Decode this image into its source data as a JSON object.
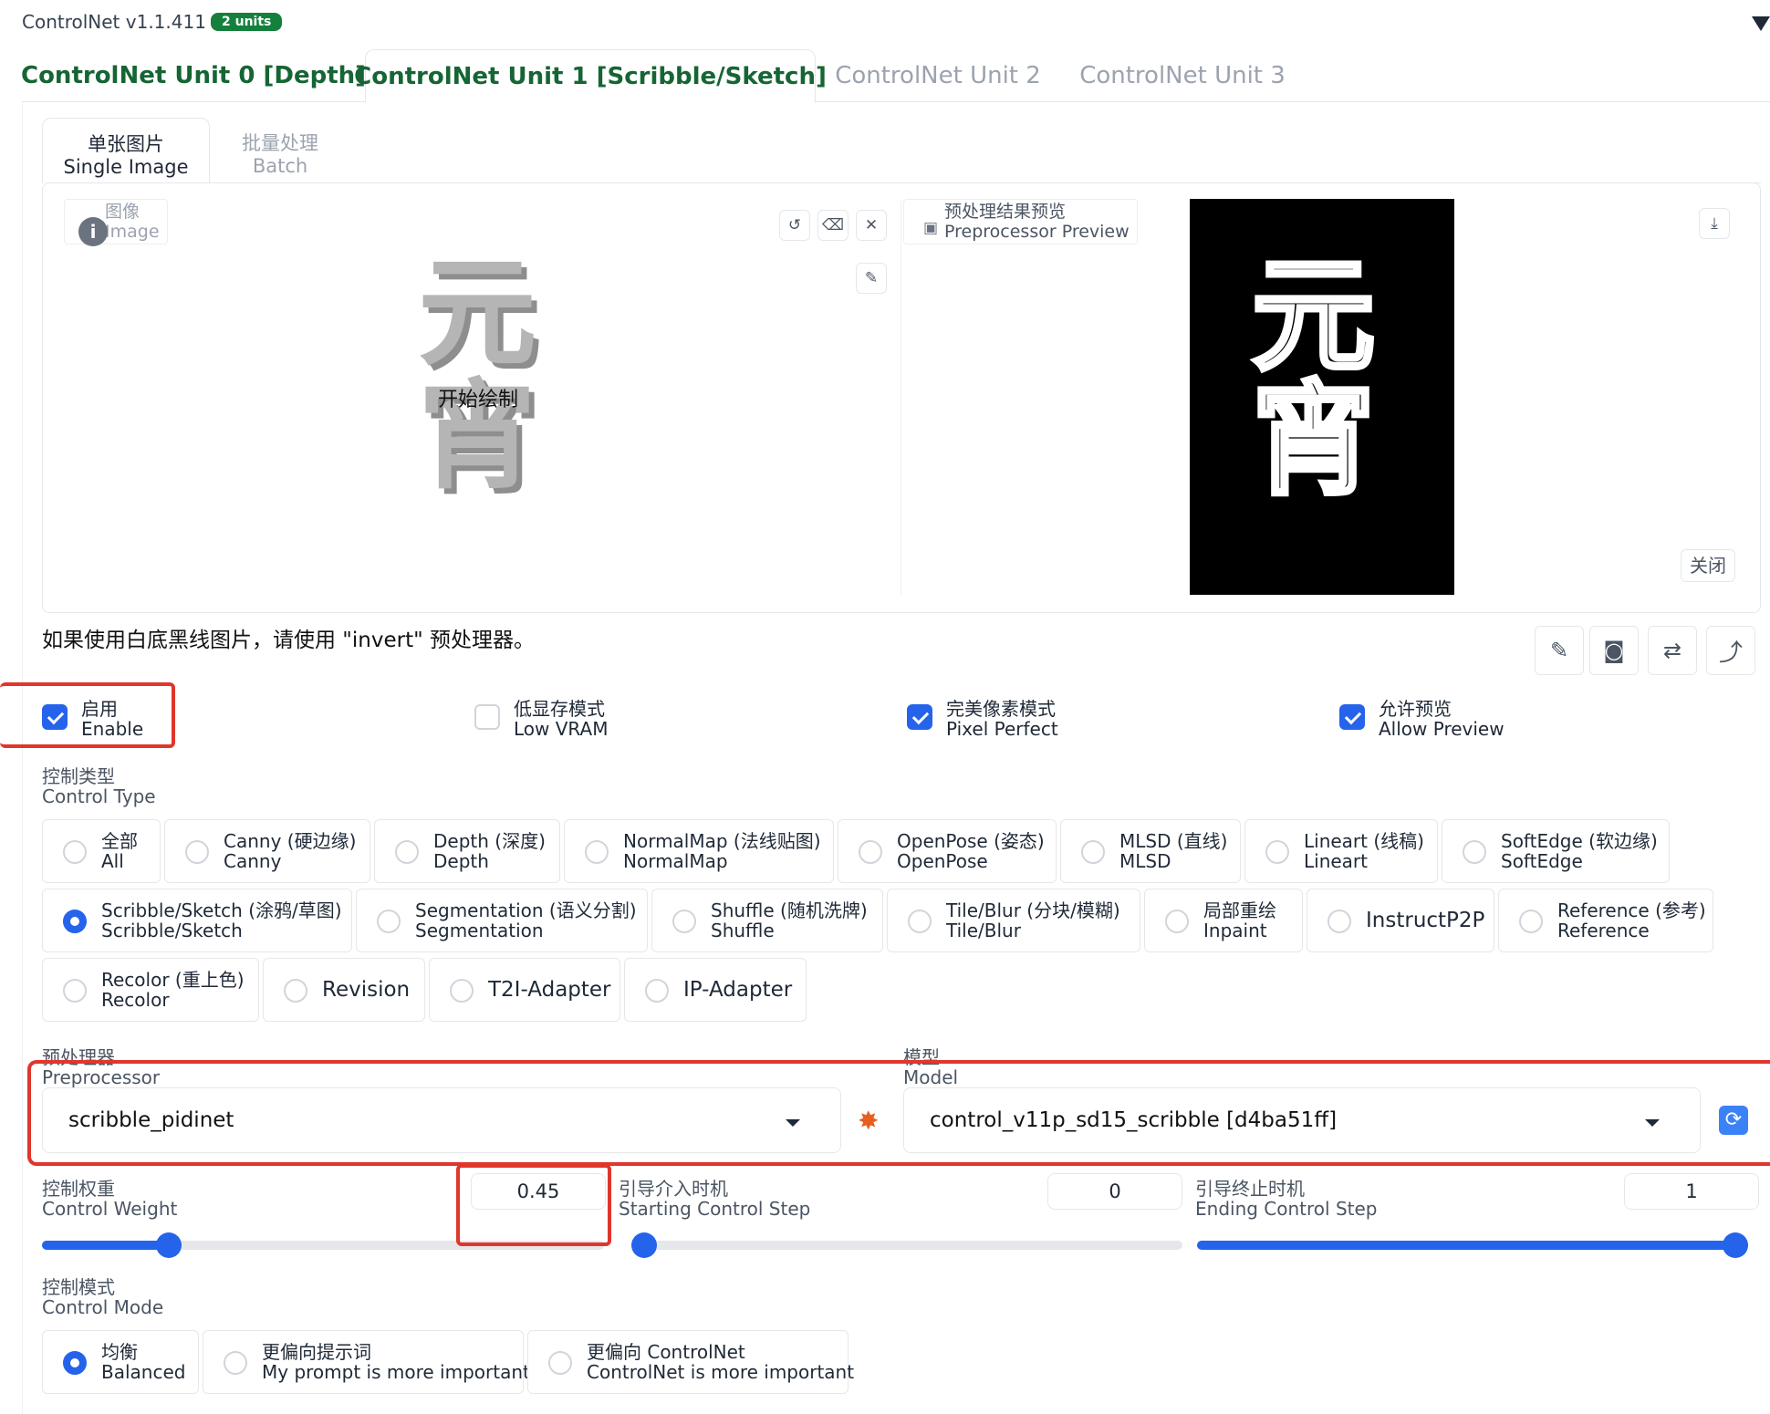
{
  "header": {
    "title": "ControlNet v1.1.411",
    "badge": "2 units"
  },
  "unit_tabs": [
    {
      "label": "ControlNet Unit 0 [Depth]"
    },
    {
      "label": "ControlNet Unit 1 [Scribble/Sketch]"
    },
    {
      "label": "ControlNet Unit 2"
    },
    {
      "label": "ControlNet Unit 3"
    }
  ],
  "mode_tabs": [
    {
      "cn": "单张图片",
      "en": "Single Image"
    },
    {
      "cn": "批量处理",
      "en": "Batch"
    }
  ],
  "image_input": {
    "label_cn": "图像",
    "label_en": "Image",
    "draw_hint": "开始绘制",
    "glyphs": [
      "元",
      "宵"
    ]
  },
  "preview": {
    "label_cn": "预处理结果预览",
    "label_en": "Preprocessor Preview",
    "close": "关闭",
    "glyphs": [
      "元",
      "宵"
    ]
  },
  "hint": "如果使用白底黑线图片，请使用 \"invert\" 预处理器。",
  "checkboxes": [
    {
      "cn": "启用",
      "en": "Enable",
      "checked": true
    },
    {
      "cn": "低显存模式",
      "en": "Low VRAM",
      "checked": false
    },
    {
      "cn": "完美像素模式",
      "en": "Pixel Perfect",
      "checked": true
    },
    {
      "cn": "允许预览",
      "en": "Allow Preview",
      "checked": true
    }
  ],
  "control_type": {
    "label_cn": "控制类型",
    "label_en": "Control Type",
    "options": [
      {
        "l1": "全部",
        "l2": "All"
      },
      {
        "l1": "Canny (硬边缘)",
        "l2": "Canny"
      },
      {
        "l1": "Depth (深度)",
        "l2": "Depth"
      },
      {
        "l1": "NormalMap (法线贴图)",
        "l2": "NormalMap"
      },
      {
        "l1": "OpenPose (姿态)",
        "l2": "OpenPose"
      },
      {
        "l1": "MLSD (直线)",
        "l2": "MLSD"
      },
      {
        "l1": "Lineart (线稿)",
        "l2": "Lineart"
      },
      {
        "l1": "SoftEdge (软边缘)",
        "l2": "SoftEdge"
      },
      {
        "l1": "Scribble/Sketch (涂鸦/草图)",
        "l2": "Scribble/Sketch",
        "selected": true
      },
      {
        "l1": "Segmentation (语义分割)",
        "l2": "Segmentation"
      },
      {
        "l1": "Shuffle (随机洗牌)",
        "l2": "Shuffle"
      },
      {
        "l1": "Tile/Blur (分块/模糊)",
        "l2": "Tile/Blur"
      },
      {
        "l1": "局部重绘",
        "l2": "Inpaint"
      },
      {
        "l1": "InstructP2P",
        "l2": ""
      },
      {
        "l1": "Reference (参考)",
        "l2": "Reference"
      },
      {
        "l1": "Recolor (重上色)",
        "l2": "Recolor"
      },
      {
        "l1": "Revision",
        "l2": ""
      },
      {
        "l1": "T2I-Adapter",
        "l2": ""
      },
      {
        "l1": "IP-Adapter",
        "l2": ""
      }
    ]
  },
  "preprocessor": {
    "label_cn": "预处理器",
    "label_en": "Preprocessor",
    "value": "scribble_pidinet"
  },
  "model": {
    "label_cn": "模型",
    "label_en": "Model",
    "value": "control_v11p_sd15_scribble [d4ba51ff]"
  },
  "control_weight": {
    "label_cn": "控制权重",
    "label_en": "Control Weight",
    "value": "0.45",
    "fraction": 0.225
  },
  "starting_step": {
    "label_cn": "引导介入时机",
    "label_en": "Starting Control Step",
    "value": "0",
    "fraction": 0
  },
  "ending_step": {
    "label_cn": "引导终止时机",
    "label_en": "Ending Control Step",
    "value": "1",
    "fraction": 1
  },
  "control_mode": {
    "label_cn": "控制模式",
    "label_en": "Control Mode",
    "options": [
      {
        "l1": "均衡",
        "l2": "Balanced",
        "selected": true
      },
      {
        "l1": "更偏向提示词",
        "l2": "My prompt is more important"
      },
      {
        "l1": "更偏向 ControlNet",
        "l2": "ControlNet is more important"
      }
    ]
  },
  "colors": {
    "accent": "#2563eb",
    "brand_green": "#166534",
    "highlight_red": "#e0362c"
  }
}
